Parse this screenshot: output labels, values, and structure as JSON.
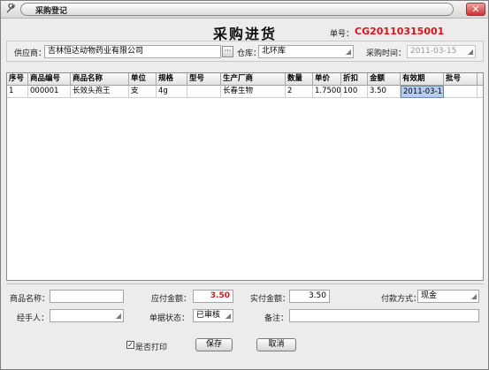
{
  "window": {
    "title": "采购登记",
    "close_glyph": "✕",
    "app_icon": "wrench-icon"
  },
  "header": {
    "title": "采购进货",
    "order_label": "单号：",
    "order_no": "CG20110315001",
    "supplier_label": "供应商：",
    "supplier_value": "吉林恒达动物药业有限公司",
    "supplier_browse": "···",
    "warehouse_label": "仓库：",
    "warehouse_value": "北环库",
    "purchase_time_label": "采购时间：",
    "purchase_time_value": "2011-03-15"
  },
  "grid": {
    "columns": [
      "序号",
      "商品编号",
      "商品名称",
      "单位",
      "规格",
      "型号",
      "生产厂商",
      "数量",
      "单价",
      "折扣",
      "金额",
      "有效期",
      "批号"
    ],
    "rows": [
      [
        "1",
        "000001",
        "长效头孢王",
        "支",
        "4g",
        "",
        "长春生物",
        "2",
        "1.7500",
        "100",
        "3.50",
        "2011-03-15",
        ""
      ]
    ]
  },
  "footer": {
    "product_name_label": "商品名称：",
    "product_name_value": "",
    "payable_label": "应付金额：",
    "payable_value": "3.50",
    "paid_label": "实付金额：",
    "paid_value": "3.50",
    "payment_method_label": "付款方式：",
    "payment_method_value": "现金",
    "handler_label": "经手人：",
    "handler_value": "",
    "doc_status_label": "单据状态：",
    "doc_status_value": "已审核",
    "remark_label": "备注：",
    "remark_value": "",
    "print_checkbox_label": "是否打印",
    "print_checked": true,
    "check_glyph": "✓",
    "save_label": "保存",
    "cancel_label": "取消"
  },
  "colors": {
    "accent_red": "#d8141c",
    "selected_cell": "#b7cdec"
  }
}
